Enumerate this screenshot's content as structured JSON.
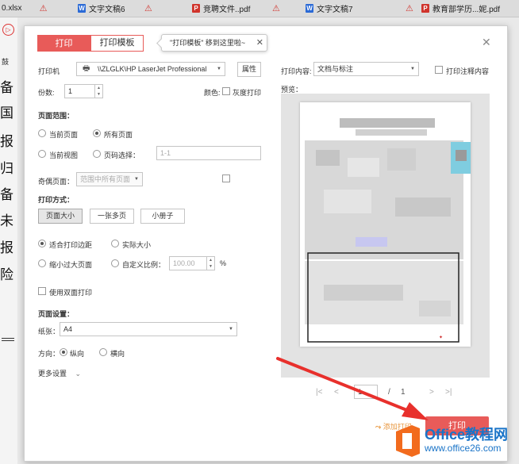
{
  "tabs": [
    {
      "label": "0.xlsx",
      "type": "xlsx"
    },
    {
      "label": "文字文稿6",
      "type": "w"
    },
    {
      "label": "竞聘文件..pdf",
      "type": "p"
    },
    {
      "label": "文字文稿7",
      "type": "w"
    },
    {
      "label": "教育部学历...妮.pdf",
      "type": "p"
    }
  ],
  "sidebar": {
    "top_label": "鼓",
    "chars": [
      "备",
      "国",
      "报",
      "归",
      "备",
      "未",
      "报",
      "险"
    ]
  },
  "dialog": {
    "print_tab": "打印",
    "template_tab": "打印模板",
    "tip": "\"打印模板\" 移到这里啦~",
    "printer_label": "打印机",
    "printer_value": "\\\\ZLGLK\\HP LaserJet Professional",
    "properties_button": "属性",
    "copies_label": "份数:",
    "copies_value": "1",
    "color_label": "颜色:",
    "grayscale_label": "灰度打印",
    "page_range_label": "页面范围：",
    "current_page": "当前页面",
    "all_pages": "所有页面",
    "current_view": "当前视图",
    "page_select": "页码选择：",
    "page_select_placeholder": "1-1",
    "odd_even_label": "奇偶页面：",
    "odd_even_value": "范围中所有页面",
    "print_mode_label": "打印方式：",
    "mode_buttons": [
      "页面大小",
      "一张多页",
      "小册子"
    ],
    "fit_margin": "适合打印边距",
    "actual_size": "实际大小",
    "shrink_large": "缩小过大页面",
    "custom_scale": "自定义比例：",
    "scale_value": "100.00",
    "percent": "%",
    "duplex": "使用双面打印",
    "page_setup_label": "页面设置：",
    "paper_label": "纸张：",
    "paper_value": "A4",
    "orientation_label": "方向：",
    "portrait": "纵向",
    "landscape": "横向",
    "more_settings": "更多设置",
    "content_label": "打印内容:",
    "content_value": "文档与标注",
    "print_comments": "打印注释内容",
    "preview_label": "预览：",
    "page_current": "1",
    "page_sep": "/",
    "page_total": "1",
    "add_printer": "添加打印",
    "print_button": "打印"
  },
  "watermark": {
    "brand": "Office教程网",
    "url": "www.office26.com"
  },
  "colors": {
    "accent": "#e85b59",
    "arrow": "#e8302c"
  }
}
